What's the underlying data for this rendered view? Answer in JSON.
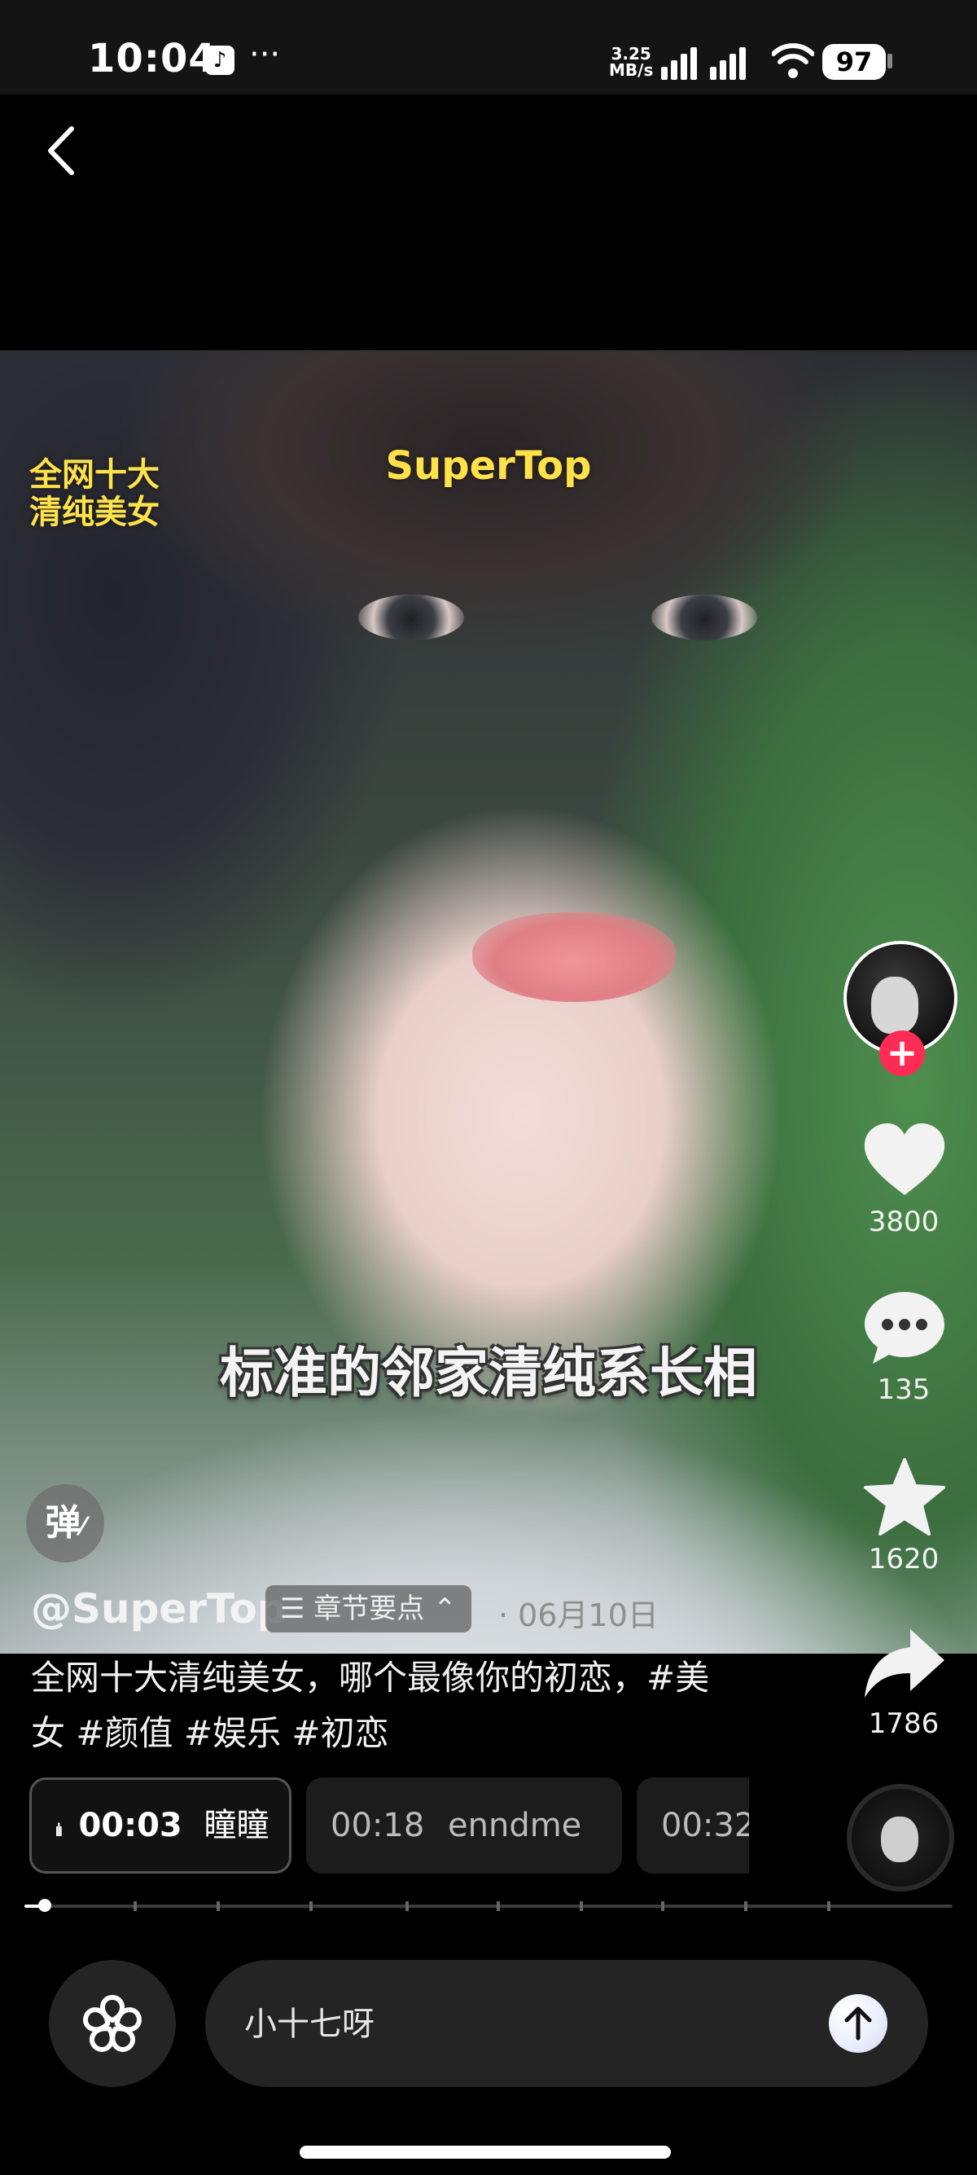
{
  "status_bar": {
    "time": "10:04",
    "network_speed_value": "3.25",
    "network_speed_unit": "MB/s",
    "battery": "97",
    "more": "···"
  },
  "video": {
    "overlay_top_left_line1": "全网十大",
    "overlay_top_left_line2": "清纯美女",
    "overlay_top_center": "SuperTop",
    "subtitle": "标准的邻家清纯系长相"
  },
  "danmaku_label": "弹",
  "post": {
    "author": "@SuperTop",
    "chapter_label": "章节要点",
    "date": "· 06月10日",
    "description_line1": "全网十大清纯美女，哪个最像你的初恋，#美",
    "description_line2": "女 #颜值 #娱乐 #初恋"
  },
  "actions": {
    "likes": "3800",
    "comments": "135",
    "favorites": "1620",
    "shares": "1786"
  },
  "chapters": [
    {
      "time": "00:03",
      "name": "瞳瞳",
      "active": true
    },
    {
      "time": "00:18",
      "name": "enndme",
      "active": false
    },
    {
      "time": "00:32",
      "name": "",
      "active": false
    }
  ],
  "progress": {
    "fraction": 0.022
  },
  "comment_input": {
    "text": "小十七呀"
  },
  "colors": {
    "overlay_yellow": "#ffe14a",
    "follow_red": "#fe2c55"
  }
}
